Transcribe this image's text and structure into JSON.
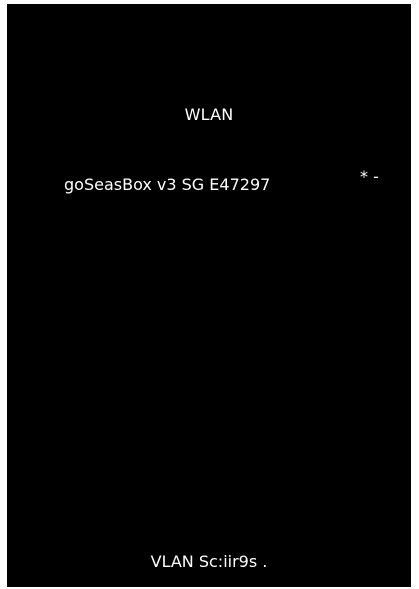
{
  "screen": {
    "title": "WLAN",
    "networks": [
      {
        "ssid": "goSeasBox v3 SG E47297",
        "flags": "* -"
      }
    ],
    "footer": "VLAN Sc:iir9s ."
  }
}
